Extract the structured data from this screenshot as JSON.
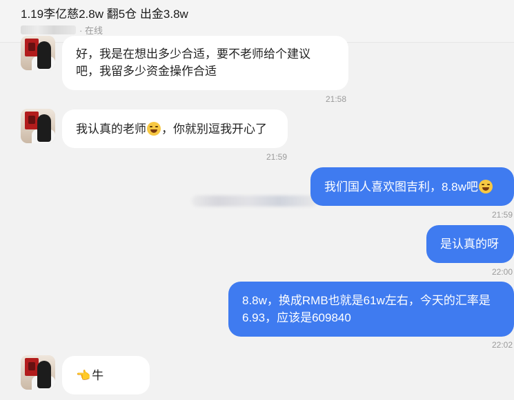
{
  "header": {
    "title": "1.19李亿慈2.8w 翻5仓 出金3.8w",
    "status": "· 在线"
  },
  "messages": [
    {
      "dir": "in",
      "lines": [
        "好，我是在想出多少合适，要不老师给个建议",
        "吧，我留多少资金操作合适"
      ],
      "time": "21:58"
    },
    {
      "dir": "in",
      "text_before": "我认真的老师",
      "emoji": "laughing-face",
      "text_after": "，你就别逗我开心了",
      "time": "21:59"
    },
    {
      "dir": "out",
      "text": "我们国人喜欢图吉利，8.8w吧",
      "emoji": "grinning-face",
      "time": "21:59"
    },
    {
      "dir": "out",
      "text": "是认真的呀",
      "time": "22:00"
    },
    {
      "dir": "out",
      "lines": [
        "8.8w，换成RMB也就是61w左右，今天的汇率是",
        "6.93，应该是609840"
      ],
      "time": "22:02"
    },
    {
      "dir": "in",
      "emoji": "hand-pointing-icon",
      "text": "牛"
    }
  ],
  "colors": {
    "outgoing": "#3f7bf0",
    "incoming": "#ffffff",
    "background": "#f2f2f2"
  }
}
